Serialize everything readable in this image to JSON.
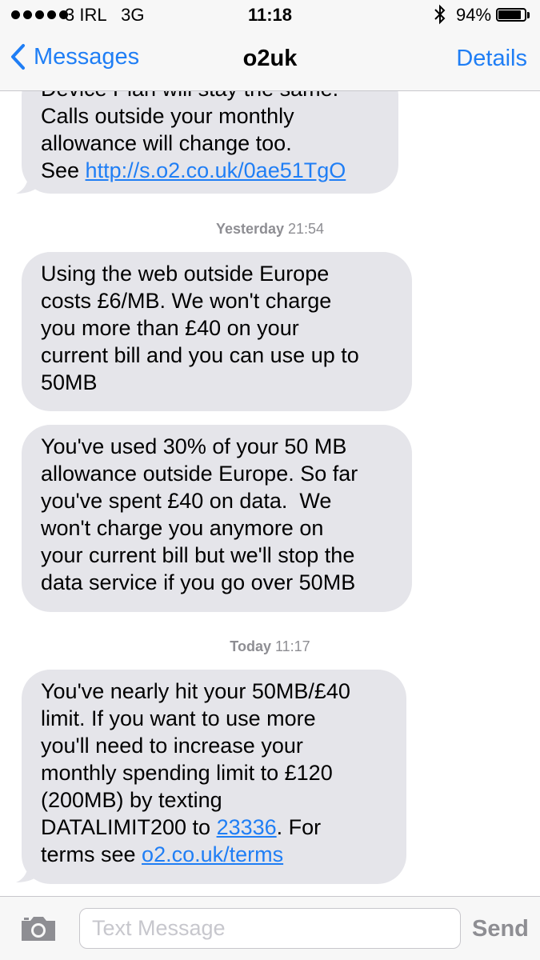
{
  "status_bar": {
    "carrier": "3 IRL   3G",
    "time": "11:18",
    "bluetooth_icon": "bluetooth-icon",
    "battery_percent": "94%",
    "battery_level": 0.94
  },
  "nav": {
    "back_label": "Messages",
    "title": "o2uk",
    "details_label": "Details"
  },
  "messages": {
    "m1": {
      "partial_line": "Device Plan will stay the same.",
      "line1": "Calls outside your monthly",
      "line2": "allowance will change too.",
      "line3_prefix": "See ",
      "link": "http://s.o2.co.uk/0ae51TgO"
    },
    "ts1": {
      "day": "Yesterday",
      "time": "21:54"
    },
    "m2": {
      "lines": [
        "Using the web outside Europe",
        "costs £6/MB. We won't charge",
        "you more than £40 on your",
        "current bill and you can use up to",
        "50MB"
      ]
    },
    "m3": {
      "lines": [
        "You've used 30% of your 50 MB",
        "allowance outside Europe. So far",
        "you've spent £40 on data.  We",
        "won't charge you anymore on",
        "your current bill but we'll stop the",
        "data service if you go over 50MB"
      ]
    },
    "ts2": {
      "day": "Today",
      "time": "11:17"
    },
    "m4": {
      "line1": "You've nearly hit your 50MB/£40",
      "line2": "limit. If you want to use more",
      "line3": "you'll need to increase your",
      "line4": "monthly spending limit to £120",
      "line5": "(200MB) by texting",
      "line6_prefix": "DATALIMIT200 to ",
      "line6_link": "23336",
      "line6_suffix": ". For",
      "line7_prefix": "terms see ",
      "line7_link": "o2.co.uk/terms"
    }
  },
  "input": {
    "camera_icon": "camera-icon",
    "placeholder": "Text Message",
    "send_label": "Send"
  },
  "colors": {
    "accent": "#1f7ef5",
    "bubble_received": "#e5e5ea",
    "timestamp": "#8e8e93"
  }
}
